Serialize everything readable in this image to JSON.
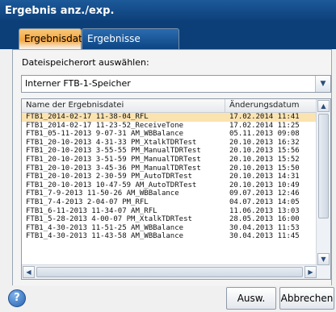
{
  "window": {
    "title": "Ergebnis anz./exp."
  },
  "tabs": [
    {
      "label": "Ergebnisdatei",
      "active": true
    },
    {
      "label": "Ergebnisse exportieren",
      "active": false
    }
  ],
  "storage": {
    "label": "Dateispeicherort auswählen:",
    "selected": "Interner FTB-1-Speicher"
  },
  "table": {
    "columns": [
      "Name der Ergebnisdatei",
      "Änderungsdatum"
    ],
    "rows": [
      {
        "name": "FTB1_2014-02-17 11-38-04_RFL",
        "date": "17.02.2014 11:41",
        "selected": true
      },
      {
        "name": "FTB1_2014-02-17 11-23-52_ReceiveTone",
        "date": "17.02.2014 11:25"
      },
      {
        "name": "FTB1_05-11-2013 9-07-31 AM_WBBalance",
        "date": "05.11.2013 09:08"
      },
      {
        "name": "FTB1_20-10-2013 4-31-33 PM_XtalkTDRTest",
        "date": "20.10.2013 16:32"
      },
      {
        "name": "FTB1_20-10-2013 3-55-55 PM_ManualTDRTest",
        "date": "20.10.2013 15:56"
      },
      {
        "name": "FTB1_20-10-2013 3-51-59 PM_ManualTDRTest",
        "date": "20.10.2013 15:52"
      },
      {
        "name": "FTB1_20-10-2013 3-45-36 PM_ManualTDRTest",
        "date": "20.10.2013 15:50"
      },
      {
        "name": "FTB1_20-10-2013 2-30-59 PM_AutoTDRTest",
        "date": "20.10.2013 14:31"
      },
      {
        "name": "FTB1_20-10-2013 10-47-59 AM_AutoTDRTest",
        "date": "20.10.2013 10:49"
      },
      {
        "name": "FTB1_7-9-2013 11-50-26 AM_WBBalance",
        "date": "09.07.2013 12:46"
      },
      {
        "name": "FTB1_7-4-2013 2-04-07 PM_RFL",
        "date": "04.07.2013 14:05"
      },
      {
        "name": "FTB1_6-11-2013 11-34-07 AM_RFL",
        "date": "11.06.2013 13:03"
      },
      {
        "name": "FTB1_5-28-2013 4-00-07 PM_XtalkTDRTest",
        "date": "28.05.2013 16:00"
      },
      {
        "name": "FTB1_4-30-2013 11-51-25 AM_WBBalance",
        "date": "30.04.2013 11:53"
      },
      {
        "name": "FTB1_4-30-2013 11-43-58 AM_WBBalance",
        "date": "30.04.2013 11:45"
      }
    ]
  },
  "buttons": {
    "ok": "Ausw.",
    "cancel": "Abbrechen"
  },
  "icons": {
    "help": "help-icon",
    "dropdown": "chevron-down-icon",
    "scroll_up": "scroll-up-icon",
    "scroll_down": "scroll-down-icon",
    "scroll_left": "scroll-left-icon",
    "scroll_right": "scroll-right-icon"
  },
  "colors": {
    "title_bar": "#0c3f78",
    "active_tab": "#f3a640",
    "selected_row": "#fbe3b0"
  }
}
